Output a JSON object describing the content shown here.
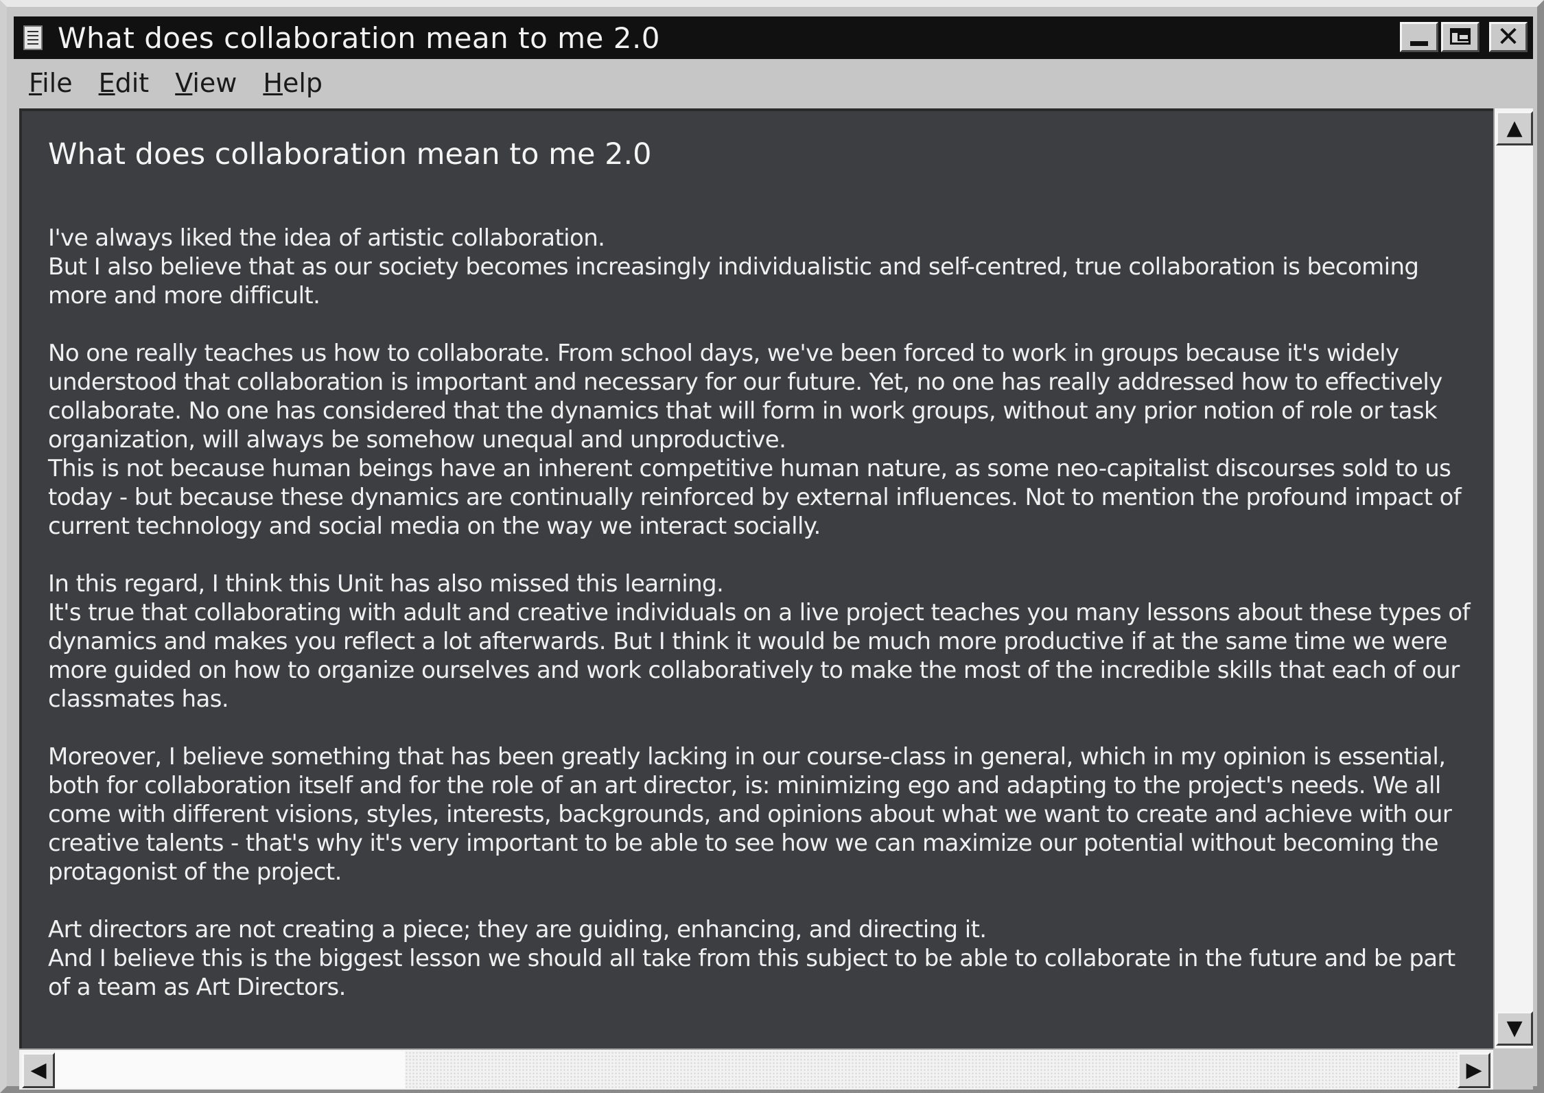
{
  "window": {
    "title": "What does collaboration mean to me 2.0",
    "app_icon": "notepad-icon",
    "controls": {
      "minimize_icon": "minimize-icon",
      "maximize_icon": "maximize-icon",
      "close_icon": "close-icon",
      "close_glyph": "✕"
    }
  },
  "menu": {
    "items": [
      {
        "mnemonic": "F",
        "rest": "ile"
      },
      {
        "mnemonic": "E",
        "rest": "dit"
      },
      {
        "mnemonic": "V",
        "rest": "iew"
      },
      {
        "mnemonic": "H",
        "rest": "elp"
      }
    ]
  },
  "document": {
    "title": "What does collaboration mean to me 2.0",
    "paragraphs": [
      {
        "lines": [
          "I've always liked the idea of artistic collaboration.",
          "But I also believe that as our society becomes increasingly individualistic and self-centred, true collaboration is becoming",
          "more and more difficult."
        ]
      },
      {
        "lines": [
          "No one really teaches us how to collaborate. From school days, we've been forced to work in groups because it's widely",
          "understood that collaboration is important and necessary for our future. Yet, no one has really addressed how to effectively",
          "collaborate. No one has considered that the dynamics that will form in work groups, without any prior notion of role or task",
          "organization, will always be somehow unequal and unproductive.",
          "This is not because human beings have an inherent competitive human nature, as some neo-capitalist discourses sold to us",
          "today - but because these dynamics are continually reinforced by external influences. Not to mention the profound impact of",
          "current technology and social media on the way we interact socially."
        ]
      },
      {
        "lines": [
          "In this regard, I think this Unit has also missed this learning.",
          "It's true that collaborating with adult and creative individuals on a live project teaches you many lessons about these types of",
          "dynamics and makes you reflect a lot afterwards. But I think it would be much more productive if at the same time we were",
          "more guided on how to organize ourselves and work collaboratively to make the most of the incredible skills that each of our",
          "classmates has."
        ]
      },
      {
        "lines": [
          "Moreover, I believe something that has been greatly lacking in our course-class in general, which in my opinion is essential,",
          "both for collaboration itself and for the role of an art director, is: minimizing ego and adapting to the project's needs. We all",
          "come with different visions, styles, interests, backgrounds, and opinions about what we want to create and achieve with our",
          "creative talents - that's why it's very important to be able to see how we can maximize our potential without becoming the",
          "protagonist of the project."
        ]
      },
      {
        "lines": [
          "Art directors are not creating a piece; they are guiding, enhancing, and directing it.",
          "And I believe this is the biggest lesson we should all take from this subject to be able to collaborate in the future and be part",
          "of a team as Art Directors."
        ]
      }
    ]
  },
  "scrollbars": {
    "up_glyph": "▲",
    "down_glyph": "▼",
    "left_glyph": "◀",
    "right_glyph": "▶"
  },
  "colors": {
    "titlebar": "#111111",
    "document_background": "#3d3e41",
    "document_text": "#f0f0f0",
    "chrome": "#c6c6c6"
  }
}
